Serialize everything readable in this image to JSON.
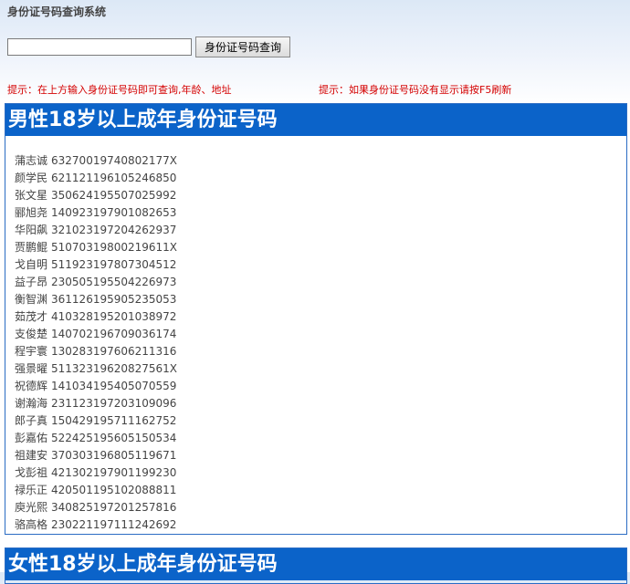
{
  "header": {
    "site_title": "身份证号码查询系统"
  },
  "search": {
    "value": "",
    "placeholder": "",
    "button_label": "身份证号码查询"
  },
  "hints": {
    "left": "提示：在上方输入身份证号码即可查询,年龄、地址",
    "right": "提示：如果身份证号码没有显示请按F5刷新"
  },
  "colors": {
    "header_bg": "#0b63c9",
    "hint_text": "#d40000",
    "border": "#2b6cc4"
  },
  "male_section": {
    "title": "男性18岁以上成年身份证号码",
    "entries": [
      {
        "name": "蒲志诚",
        "id": "63270019740802177X"
      },
      {
        "name": "颜学民",
        "id": "621121196105246850"
      },
      {
        "name": "张文星",
        "id": "350624195507025992"
      },
      {
        "name": "郦旭尧",
        "id": "140923197901082653"
      },
      {
        "name": "华阳飙",
        "id": "321023197204262937"
      },
      {
        "name": "贾鹏鲲",
        "id": "51070319800219611X"
      },
      {
        "name": "戈自明",
        "id": "511923197807304512"
      },
      {
        "name": "益子昂",
        "id": "230505195504226973"
      },
      {
        "name": "衡智渊",
        "id": "361126195905235053"
      },
      {
        "name": "茹茂才",
        "id": "410328195201038972"
      },
      {
        "name": "支俊楚",
        "id": "140702196709036174"
      },
      {
        "name": "程宇寰",
        "id": "130283197606211316"
      },
      {
        "name": "强景曜",
        "id": "51132319620827561X"
      },
      {
        "name": "祝德辉",
        "id": "141034195405070559"
      },
      {
        "name": "谢瀚海",
        "id": "231123197203109096"
      },
      {
        "name": "郎子真",
        "id": "150429195711162752"
      },
      {
        "name": "彭嘉佑",
        "id": "522425195605150534"
      },
      {
        "name": "祖建安",
        "id": "370303196805119671"
      },
      {
        "name": "戈彭祖",
        "id": "421302197901199230"
      },
      {
        "name": "禄乐正",
        "id": "420501195102088811"
      },
      {
        "name": "庾光熙",
        "id": "340825197201257816"
      },
      {
        "name": "骆高格",
        "id": "230221197111242692"
      }
    ]
  },
  "female_section": {
    "title": "女性18岁以上成年身份证号码"
  }
}
